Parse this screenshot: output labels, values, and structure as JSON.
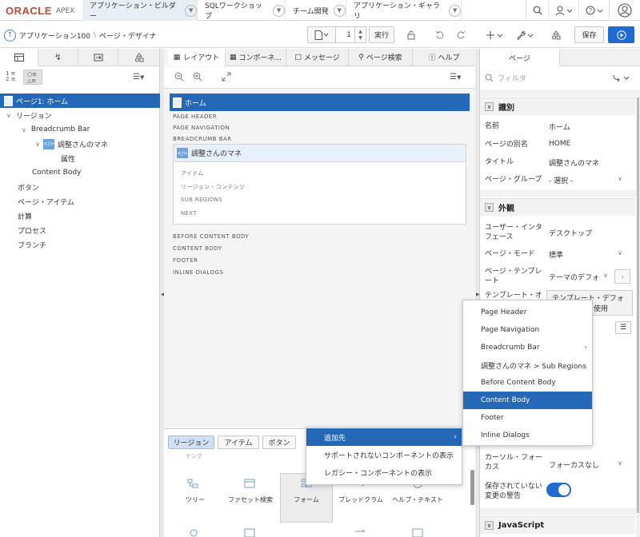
{
  "topbar": {
    "logo_oracle": "ORACLE",
    "logo_apex": "APEX",
    "tabs": [
      {
        "label": "アプリケーション・ビルダー"
      },
      {
        "label": "SQLワークショップ"
      },
      {
        "label": "チーム開発"
      },
      {
        "label": "アプリケーション・ギャラリ"
      }
    ]
  },
  "toolbar": {
    "breadcrumb_app": "アプリケーション100",
    "breadcrumb_sep": "\\",
    "breadcrumb_page": "ページ・デザイナ",
    "page_number": "1",
    "run_label": "実行",
    "save_label": "保存"
  },
  "left": {
    "tree": [
      {
        "label": "ページ1: ホーム"
      },
      {
        "label": "リージョン"
      },
      {
        "label": "Breadcrumb Bar"
      },
      {
        "label": "調整さんのマネ"
      },
      {
        "label": "属性"
      },
      {
        "label": "Content Body"
      },
      {
        "label": "ボタン"
      },
      {
        "label": "ページ・アイテム"
      },
      {
        "label": "計算"
      },
      {
        "label": "プロセス"
      },
      {
        "label": "ブランチ"
      }
    ]
  },
  "middle": {
    "tabs": [
      {
        "label": "レイアウト"
      },
      {
        "label": "コンポーネ..."
      },
      {
        "label": "メッセージ"
      },
      {
        "label": "ページ検索"
      },
      {
        "label": "ヘルプ"
      }
    ],
    "page_title": "ホーム",
    "regions_top": [
      "PAGE HEADER",
      "PAGE NAVIGATION",
      "BREADCRUMB BAR"
    ],
    "region_card_title": "調整さんのマネ",
    "sub_regions": [
      "アイテム",
      "リージョン・コンテンツ",
      "SUB REGIONS",
      "NEXT"
    ],
    "regions_bottom": [
      "BEFORE CONTENT BODY",
      "CONTENT BODY",
      "FOOTER",
      "INLINE DIALOGS"
    ],
    "gallery_tabs": [
      {
        "label": "リージョン"
      },
      {
        "label": "アイテム"
      },
      {
        "label": "ボタン"
      }
    ],
    "gallery_items": [
      {
        "label": "ツリー"
      },
      {
        "label": "ファセット検索"
      },
      {
        "label": "フォーム"
      },
      {
        "label": "ブレッドクラム"
      },
      {
        "label": "ヘルプ・テキスト"
      }
    ],
    "gallery_partial_label": "ナンブ"
  },
  "right": {
    "tab_label": "ページ",
    "filter_placeholder": "フィルタ",
    "sections": {
      "identity": "識別",
      "appearance": "外観",
      "javascript": "JavaScript"
    },
    "props": {
      "name_label": "名前",
      "name_value": "ホーム",
      "alias_label": "ページの別名",
      "alias_value": "HOME",
      "title_label": "タイトル",
      "title_value": "調整さんのマネ",
      "group_label": "ページ・グループ",
      "group_value": "- 選択 -",
      "ui_label": "ユーザー・インタフェース",
      "ui_value": "デスクトップ",
      "mode_label": "ページ・モード",
      "mode_value": "標準",
      "template_label": "ページ・テンプレート",
      "template_value": "テーマのデフォ",
      "template_opt_label": "テンプレート・オ",
      "template_opt_value": "テンプレート・デフォ",
      "template_opt_value2": "使用",
      "cursor_label": "カーソル・フォーカス",
      "cursor_value": "フォーカスなし",
      "warn_label": "保存されていない変更の警告"
    }
  },
  "context_menu": {
    "items": [
      {
        "label": "追加先"
      },
      {
        "label": "サポートされないコンポーネントの表示"
      },
      {
        "label": "レガシー・コンポーネントの表示"
      }
    ]
  },
  "submenu": {
    "items": [
      {
        "label": "Page Header"
      },
      {
        "label": "Page Navigation"
      },
      {
        "label": "Breadcrumb Bar"
      },
      {
        "label": "調整さんのマネ > Sub Regions"
      },
      {
        "label": "Before Content Body"
      },
      {
        "label": "Content Body"
      },
      {
        "label": "Footer"
      },
      {
        "label": "Inline Dialogs"
      }
    ]
  },
  "colors": {
    "accent": "#2568b8",
    "oracle_red": "#c74634",
    "toggle": "#1f6bd0"
  }
}
